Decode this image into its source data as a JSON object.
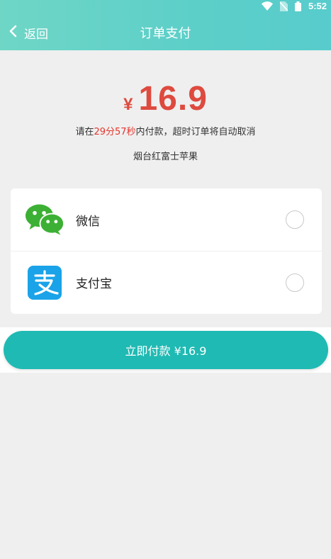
{
  "status_bar": {
    "time": "5:52"
  },
  "header": {
    "back_label": "返回",
    "title": "订单支付"
  },
  "order": {
    "currency_symbol": "¥",
    "amount": "16.9",
    "countdown_prefix": "请在",
    "countdown_value": "29分57秒",
    "countdown_suffix": "内付款，超时订单将自动取消",
    "product_name": "烟台红富士苹果"
  },
  "payment_methods": [
    {
      "label": "微信",
      "icon": "wechat-icon",
      "selected": false
    },
    {
      "label": "支付宝",
      "icon": "alipay-icon",
      "selected": false
    }
  ],
  "pay_button": {
    "label": "立即付款 ¥16.9"
  },
  "colors": {
    "accent": "#1fbab3",
    "price": "#de4a3f",
    "countdown_highlight": "#e5362d",
    "wechat_green": "#3cb034",
    "alipay_blue": "#1aa3e8"
  }
}
